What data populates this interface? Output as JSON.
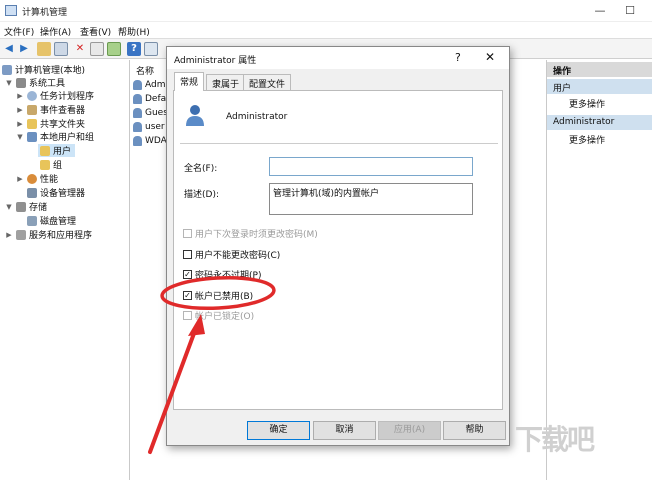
{
  "window": {
    "title": "计算机管理",
    "controls": [
      "—",
      "☐",
      "✕"
    ]
  },
  "menu": [
    "文件(F)",
    "操作(A)",
    "查看(V)",
    "帮助(H)"
  ],
  "tree": {
    "root": "计算机管理(本地)",
    "system_tools": "系统工具",
    "task_scheduler": "任务计划程序",
    "event_viewer": "事件查看器",
    "shared_folders": "共享文件夹",
    "local_users": "本地用户和组",
    "users": "用户",
    "groups": "组",
    "performance": "性能",
    "device_manager": "设备管理器",
    "storage": "存储",
    "disk_mgmt": "磁盘管理",
    "services": "服务和应用程序"
  },
  "list": {
    "header": "名称",
    "rows": [
      "Admi",
      "Defa",
      "Gues",
      "user",
      "WDA"
    ]
  },
  "actions": {
    "header": "操作",
    "section1": "用户",
    "more1": "更多操作",
    "section2": "Administrator",
    "more2": "更多操作"
  },
  "dialog": {
    "title": "Administrator 属性",
    "help": "?",
    "close": "✕",
    "tabs": [
      "常规",
      "隶属于",
      "配置文件"
    ],
    "username": "Administrator",
    "fullname_label": "全名(F):",
    "fullname_value": "",
    "desc_label": "描述(D):",
    "desc_value": "管理计算机(域)的内置帐户",
    "checkboxes": [
      {
        "label": "用户下次登录时须更改密码(M)",
        "checked": false,
        "enabled": false
      },
      {
        "label": "用户不能更改密码(C)",
        "checked": false,
        "enabled": true
      },
      {
        "label": "密码永不过期(P)",
        "checked": true,
        "enabled": true
      },
      {
        "label": "帐户已禁用(B)",
        "checked": true,
        "enabled": true
      },
      {
        "label": "帐户已锁定(O)",
        "checked": false,
        "enabled": false
      }
    ],
    "buttons": {
      "ok": "确定",
      "cancel": "取消",
      "apply": "应用(A)",
      "help": "帮助"
    }
  },
  "annotation": {
    "color": "#e02a2a"
  },
  "watermark": "下载吧"
}
